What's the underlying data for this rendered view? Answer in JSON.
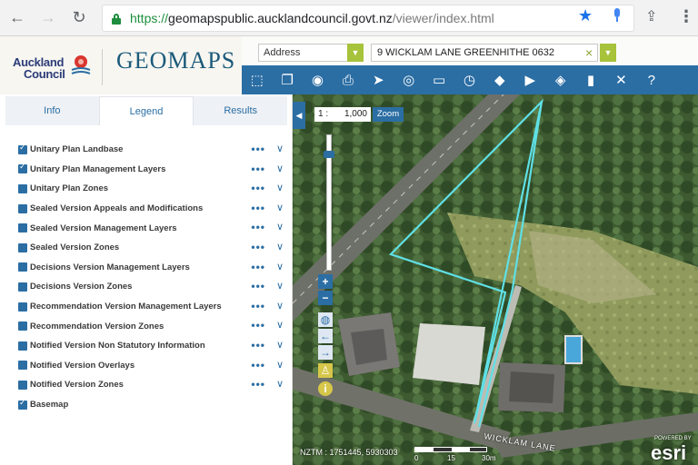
{
  "browser": {
    "back_icon": "back-arrow-icon",
    "forward_icon": "forward-arrow-icon",
    "reload_icon": "reload-icon",
    "url_scheme": "https://",
    "url_host": "geomapspublic.aucklandcouncil.govt.nz",
    "url_path": "/viewer/index.html"
  },
  "brand": {
    "logo_line1": "Auckland",
    "logo_line2": "Council",
    "app_name": "GEOMAPS"
  },
  "search": {
    "type_value": "Address",
    "address_value": "9 WICKLAM LANE GREENHITHE 0632"
  },
  "toolbar": {
    "items": [
      {
        "name": "measure-area-icon",
        "glyph": "⬚"
      },
      {
        "name": "layers-icon",
        "glyph": "❐"
      },
      {
        "name": "eye-icon",
        "glyph": "◉"
      },
      {
        "name": "print-icon",
        "glyph": "⎙"
      },
      {
        "name": "select-pointer-icon",
        "glyph": "➤"
      },
      {
        "name": "locate-target-icon",
        "glyph": "◎"
      },
      {
        "name": "ruler-icon",
        "glyph": "▭"
      },
      {
        "name": "history-clock-icon",
        "glyph": "◷"
      },
      {
        "name": "water-drop-icon",
        "glyph": "◆"
      },
      {
        "name": "camera-icon",
        "glyph": "▶"
      },
      {
        "name": "place-pin-icon",
        "glyph": "◈"
      },
      {
        "name": "bookmark-icon",
        "glyph": "▮"
      },
      {
        "name": "tools-icon",
        "glyph": "✕"
      },
      {
        "name": "help-icon",
        "glyph": "?"
      }
    ]
  },
  "panel": {
    "tabs": [
      "Info",
      "Legend",
      "Results"
    ],
    "active_tab": 1,
    "layers": [
      {
        "name": "Unitary Plan Landbase",
        "checked": true,
        "options": true
      },
      {
        "name": "Unitary Plan Management Layers",
        "checked": true,
        "options": true
      },
      {
        "name": "Unitary Plan Zones",
        "checked": false,
        "options": true
      },
      {
        "name": "Sealed Version Appeals and Modifications",
        "checked": false,
        "options": true
      },
      {
        "name": "Sealed Version Management Layers",
        "checked": false,
        "options": true
      },
      {
        "name": "Sealed Version Zones",
        "checked": false,
        "options": true
      },
      {
        "name": "Decisions Version Management Layers",
        "checked": false,
        "options": true
      },
      {
        "name": "Decisions Version Zones",
        "checked": false,
        "options": true
      },
      {
        "name": "Recommendation Version Management Layers",
        "checked": false,
        "options": true
      },
      {
        "name": "Recommendation Version Zones",
        "checked": false,
        "options": true
      },
      {
        "name": "Notified Version Non Statutory Information",
        "checked": false,
        "options": true
      },
      {
        "name": "Notified Version Overlays",
        "checked": false,
        "options": true
      },
      {
        "name": "Notified Version Zones",
        "checked": false,
        "options": true
      },
      {
        "name": "Basemap",
        "checked": true,
        "options": false
      }
    ]
  },
  "map": {
    "scale_prefix": "1 :",
    "scale_value": "1,000",
    "zoom_label": "Zoom",
    "zoom_in": "+",
    "zoom_out": "−",
    "coordinates": "NZTM : 1751445, 5930303",
    "scale_ticks": [
      "0",
      "15",
      "30m"
    ],
    "road_label": "WICKLAM LANE",
    "powered_by": "POWERED BY",
    "esri": "esri",
    "parcel_color": "#5fe0e6",
    "toolbar_color": "#2b6ea4"
  }
}
